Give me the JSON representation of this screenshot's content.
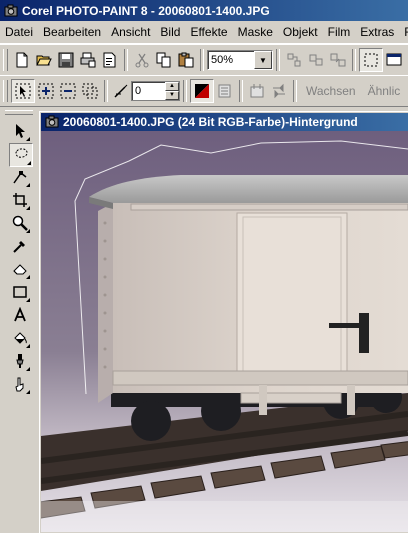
{
  "window": {
    "title": "Corel PHOTO-PAINT 8 - 20060801-1400.JPG",
    "icon": "camera-icon"
  },
  "menu": [
    {
      "label": "Datei"
    },
    {
      "label": "Bearbeiten"
    },
    {
      "label": "Ansicht"
    },
    {
      "label": "Bild"
    },
    {
      "label": "Effekte"
    },
    {
      "label": "Maske"
    },
    {
      "label": "Objekt"
    },
    {
      "label": "Film"
    },
    {
      "label": "Extras"
    },
    {
      "label": "Fer"
    }
  ],
  "toolbar1": {
    "zoom_value": "50%"
  },
  "toolbar2": {
    "feather_value": "0",
    "grow_label": "Wachsen",
    "similar_label": "Ähnlic"
  },
  "document": {
    "title": "20060801-1400.JPG  (24 Bit RGB-Farbe)-Hintergrund",
    "icon": "camera-icon"
  },
  "colors": {
    "title_start": "#0a246a",
    "title_end": "#3a6ea5",
    "chrome": "#d4d0c8",
    "canvas_bg": "#7a6f86"
  }
}
